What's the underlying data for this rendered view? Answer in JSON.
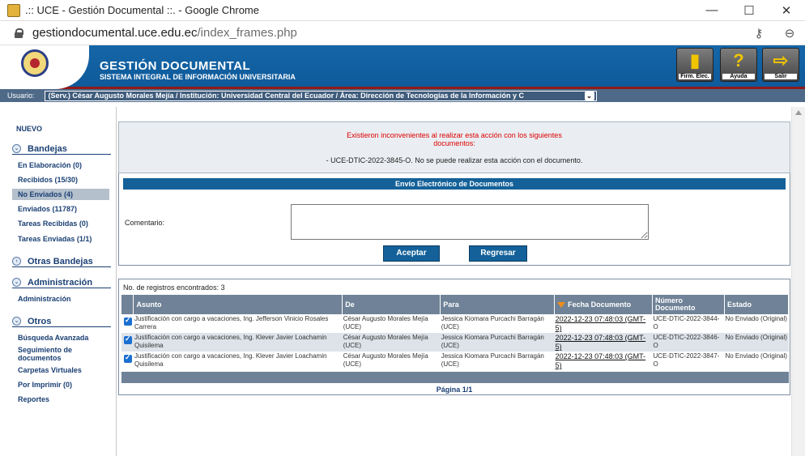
{
  "browser": {
    "title": ".:: UCE - Gestión Documental ::. - Google Chrome",
    "url_host": "gestiondocumental.uce.edu.ec",
    "url_path": "/index_frames.php"
  },
  "header": {
    "title": "GESTIÓN DOCUMENTAL",
    "subtitle": "SISTEMA INTEGRAL DE INFORMACIÓN UNIVERSITARIA",
    "buttons": {
      "firma": "Firm. Elec.",
      "ayuda": "Ayuda",
      "salir": "Salir"
    }
  },
  "userbar": {
    "label": "Usuario:",
    "value": "(Serv.) César Augusto Morales Mejía / Institución: Universidad Central del Ecuador / Área: Dirección de Tecnologías de la Información y C"
  },
  "sidebar": {
    "nuevo": "NUEVO",
    "bandejas": "Bandejas",
    "items": [
      "En Elaboración (0)",
      "Recibidos (15/30)",
      "No Enviados (4)",
      "Enviados (11787)",
      "Tareas Recibidas (0)",
      "Tareas Enviadas (1/1)"
    ],
    "otras_bandejas": "Otras Bandejas",
    "administracion": "Administración",
    "admin_item": "Administración",
    "otros": "Otros",
    "otros_items": [
      "Búsqueda Avanzada",
      "Seguimiento de documentos",
      "Carpetas Virtuales",
      "Por Imprimir (0)",
      "Reportes"
    ]
  },
  "message": {
    "error_line1": "Existieron inconvenientes al realizar esta acción con los siguientes",
    "error_line2": "documentos:",
    "detail": "- UCE-DTIC-2022-3845-O. No se puede realizar esta acción con el documento."
  },
  "envio": {
    "title": "Envío Electrónico de Documentos",
    "comment_label": "Comentario:",
    "comment_value": "",
    "accept": "Aceptar",
    "back": "Regresar"
  },
  "table": {
    "count": "No. de registros encontrados: 3",
    "headers": [
      "Asunto",
      "De",
      "Para",
      "Fecha Documento",
      "Número Documento",
      "Estado"
    ],
    "rows": [
      {
        "asunto": "Justificación con cargo a vacaciones, Ing. Jefferson Vinicio Rosales Carrera",
        "de": "César Augusto Morales Mejía (UCE)",
        "para": "Jessica Kiomara Purcachi Barragán (UCE)",
        "fecha": "2022-12-23 07:48:03 (GMT-5)",
        "numero": "UCE-DTIC-2022-3844-O",
        "estado": "No Enviado (Original)"
      },
      {
        "asunto": "Justificación con cargo a vacaciones, Ing. Klever Javier Loachamin Quisilema",
        "de": "César Augusto Morales Mejía (UCE)",
        "para": "Jessica Kiomara Purcachi Barragán (UCE)",
        "fecha": "2022-12-23 07:48:03 (GMT-5)",
        "numero": "UCE-DTIC-2022-3846-O",
        "estado": "No Enviado (Original)"
      },
      {
        "asunto": "Justificación con cargo a vacaciones, Ing. Klever Javier Loachamin Quisilema",
        "de": "César Augusto Morales Mejía (UCE)",
        "para": "Jessica Kiomara Purcachi Barragán (UCE)",
        "fecha": "2022-12-23 07:48:03 (GMT-5)",
        "numero": "UCE-DTIC-2022-3847-O",
        "estado": "No Enviado (Original)"
      }
    ],
    "pagina": "Página 1/1"
  }
}
